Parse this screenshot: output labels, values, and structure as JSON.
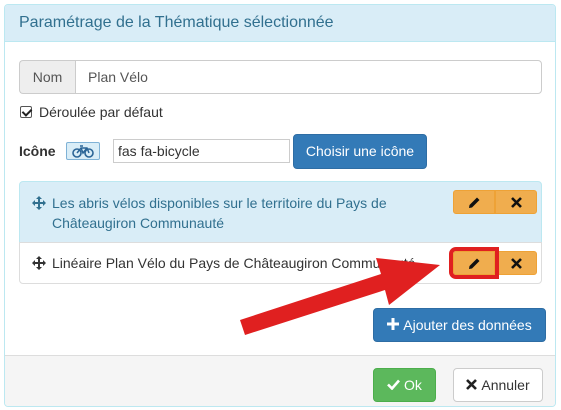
{
  "dialog": {
    "title": "Paramétrage de la Thématique sélectionnée"
  },
  "name_field": {
    "label": "Nom",
    "value": "Plan Vélo"
  },
  "default_open": {
    "label": "Déroulée par défaut",
    "checked": true
  },
  "icon_field": {
    "label": "Icône",
    "preview_icon": "bicycle-icon",
    "value": "fas fa-bicycle",
    "choose_button": "Choisir une icône"
  },
  "layers": [
    {
      "label": "Les abris vélos disponibles sur le territoire du Pays de Châteaugiron Communauté",
      "edit_icon": "pencil-icon",
      "delete_icon": "times-icon"
    },
    {
      "label": "Linéaire Plan Vélo du Pays de Châteaugiron Communauté",
      "edit_icon": "pencil-icon",
      "delete_icon": "times-icon"
    }
  ],
  "add_data_button": "Ajouter des données",
  "footer": {
    "ok_label": "Ok",
    "cancel_label": "Annuler"
  },
  "colors": {
    "header_bg": "#d9edf7",
    "primary": "#337ab7",
    "warning": "#f0ad4e",
    "success": "#5cb85c",
    "annotation": "#e02020"
  }
}
